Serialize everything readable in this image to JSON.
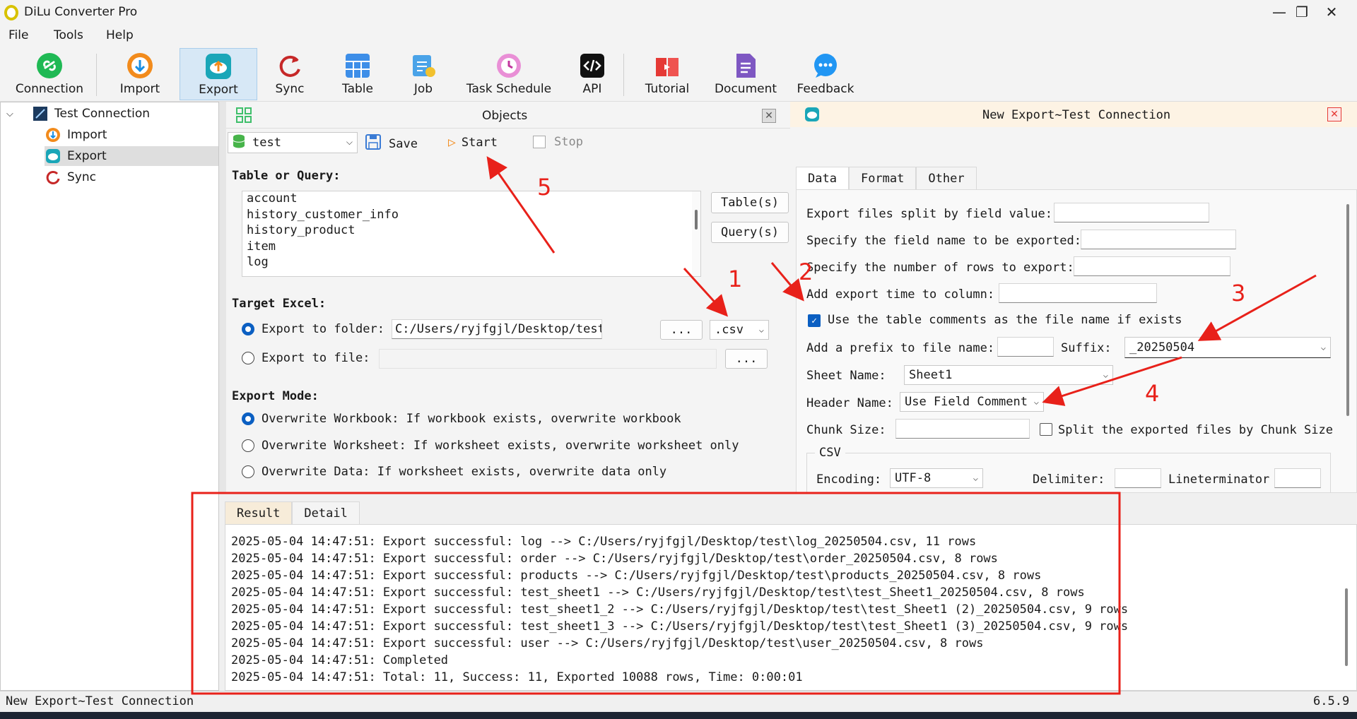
{
  "window": {
    "title": "DiLu Converter Pro",
    "minimize": "—",
    "maximize": "❐",
    "close": "✕"
  },
  "menu": [
    "File",
    "Tools",
    "Help"
  ],
  "toolbar": {
    "connection": "Connection",
    "import": "Import",
    "export": "Export",
    "sync": "Sync",
    "table": "Table",
    "job": "Job",
    "task_schedule": "Task Schedule",
    "api": "API",
    "tutorial": "Tutorial",
    "document": "Document",
    "feedback": "Feedback"
  },
  "tree": {
    "root": "Test Connection",
    "children": [
      "Import",
      "Export",
      "Sync"
    ],
    "selected": "Export"
  },
  "objects_panel": {
    "title": "Objects",
    "database": "test",
    "save": "Save",
    "start": "Start",
    "stop": "Stop",
    "table_or_query_label": "Table or Query:",
    "tables": [
      "account",
      "history_customer_info",
      "history_product",
      "item",
      "log"
    ],
    "tables_button": "Table(s)",
    "query_button": "Query(s)",
    "target_excel_label": "Target Excel:",
    "export_to_folder_label": "Export to folder:",
    "folder_path": "C:/Users/ryjfgjl/Desktop/test",
    "browse_button": "...",
    "format": ".csv",
    "export_to_file_label": "Export to file:",
    "file_path": "",
    "export_mode_label": "Export Mode:",
    "modes": [
      "Overwrite Workbook: If workbook exists, overwrite workbook",
      "Overwrite Worksheet: If worksheet exists, overwrite worksheet only",
      "Overwrite Data: If worksheet exists, overwrite data only"
    ],
    "selected_mode": 0
  },
  "export_panel": {
    "title": "New Export~Test Connection",
    "tabs": [
      "Data",
      "Format",
      "Other"
    ],
    "active_tab": "Data",
    "split_by_field_label": "Export files split by field value:",
    "field_name_label": "Specify the field name to be exported:",
    "num_rows_label": "Specify the number of rows to export:",
    "export_time_label": "Add export time to column:",
    "use_comments_label": "Use the table comments as the file name if exists",
    "use_comments_checked": true,
    "prefix_label": "Add a prefix to file name:",
    "prefix_value": "",
    "suffix_label": "Suffix:",
    "suffix_value": "_20250504",
    "sheet_name_label": "Sheet Name:",
    "sheet_name_value": "Sheet1",
    "header_name_label": "Header Name:",
    "header_name_value": "Use Field Comment",
    "chunk_size_label": "Chunk Size:",
    "chunk_size_value": "",
    "split_chunk_label": "Split the exported files by Chunk Size",
    "csv_group_label": "CSV",
    "encoding_label": "Encoding:",
    "encoding_value": "UTF-8",
    "delimiter_label": "Delimiter:",
    "lineterminator_label": "Lineterminator"
  },
  "result": {
    "tabs": [
      "Result",
      "Detail"
    ],
    "active_tab": "Result",
    "lines": [
      "2025-05-04 14:47:51: Export successful: log --> C:/Users/ryjfgjl/Desktop/test\\log_20250504.csv, 11 rows",
      "2025-05-04 14:47:51: Export successful: order --> C:/Users/ryjfgjl/Desktop/test\\order_20250504.csv, 8 rows",
      "2025-05-04 14:47:51: Export successful: products --> C:/Users/ryjfgjl/Desktop/test\\products_20250504.csv, 8 rows",
      "2025-05-04 14:47:51: Export successful: test_sheet1 --> C:/Users/ryjfgjl/Desktop/test\\test_Sheet1_20250504.csv, 8 rows",
      "2025-05-04 14:47:51: Export successful: test_sheet1_2 --> C:/Users/ryjfgjl/Desktop/test\\test_Sheet1 (2)_20250504.csv, 9 rows",
      "2025-05-04 14:47:51: Export successful: test_sheet1_3 --> C:/Users/ryjfgjl/Desktop/test\\test_Sheet1 (3)_20250504.csv, 9 rows",
      "2025-05-04 14:47:51: Export successful: user --> C:/Users/ryjfgjl/Desktop/test\\user_20250504.csv, 8 rows",
      "2025-05-04 14:47:51: Completed",
      "2025-05-04 14:47:51: Total: 11, Success: 11, Exported 10088 rows, Time: 0:00:01"
    ]
  },
  "status": {
    "left": "New Export~Test Connection",
    "version": "6.5.9"
  },
  "annotations": [
    "1",
    "2",
    "3",
    "4",
    "5"
  ],
  "colors": {
    "accent": "#0b5fc2",
    "annotation": "#e8211a",
    "export_header": "#fdf3e4",
    "toolbar_active": "#d7e8f6"
  }
}
